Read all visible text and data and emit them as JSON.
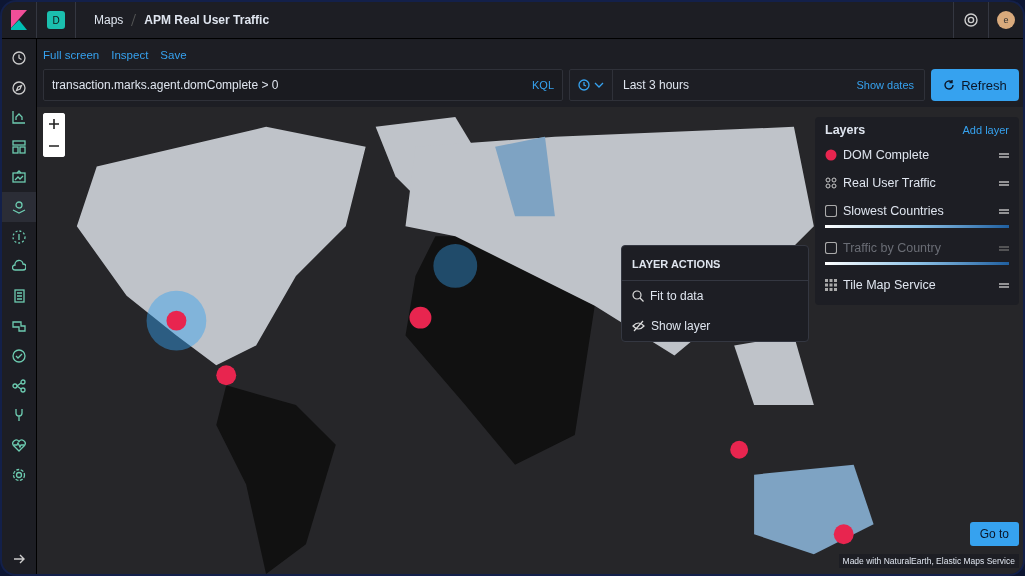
{
  "header": {
    "space_letter": "D",
    "breadcrumbs": [
      "Maps",
      "APM Real User Traffic"
    ],
    "avatar_letter": "e"
  },
  "sidebar": {
    "items": [
      {
        "selected": false
      },
      {
        "selected": false
      },
      {
        "selected": false
      },
      {
        "selected": false
      },
      {
        "selected": false
      },
      {
        "selected": true
      },
      {
        "selected": false
      },
      {
        "selected": false
      },
      {
        "selected": false
      },
      {
        "selected": false
      },
      {
        "selected": false
      },
      {
        "selected": false
      },
      {
        "selected": false
      },
      {
        "selected": false
      },
      {
        "selected": false
      }
    ]
  },
  "top_links": [
    "Full screen",
    "Inspect",
    "Save"
  ],
  "query": {
    "value": "transaction.marks.agent.domComplete > 0",
    "language": "KQL"
  },
  "time": {
    "range": "Last 3 hours",
    "show_dates": "Show dates"
  },
  "refresh_button": "Refresh",
  "layers_panel": {
    "title": "Layers",
    "add_layer": "Add layer",
    "layers": [
      {
        "name": "DOM Complete",
        "kind": "point",
        "color": "#e8254f",
        "hidden": false,
        "legend": false
      },
      {
        "name": "Real User Traffic",
        "kind": "cluster",
        "hidden": false,
        "legend": false
      },
      {
        "name": "Slowest Countries",
        "kind": "polygon",
        "hidden": false,
        "legend": true
      },
      {
        "name": "Traffic by Country",
        "kind": "polygon",
        "hidden": true,
        "legend": true
      },
      {
        "name": "Tile Map Service",
        "kind": "tiles",
        "hidden": false,
        "legend": false
      }
    ]
  },
  "layer_actions": {
    "title": "LAYER ACTIONS",
    "actions": [
      {
        "label": "Fit to data",
        "kind": "fit"
      },
      {
        "label": "Show layer",
        "kind": "show"
      }
    ]
  },
  "goto_button": "Go to",
  "attribution": "Made with NaturalEarth, Elastic Maps Service"
}
